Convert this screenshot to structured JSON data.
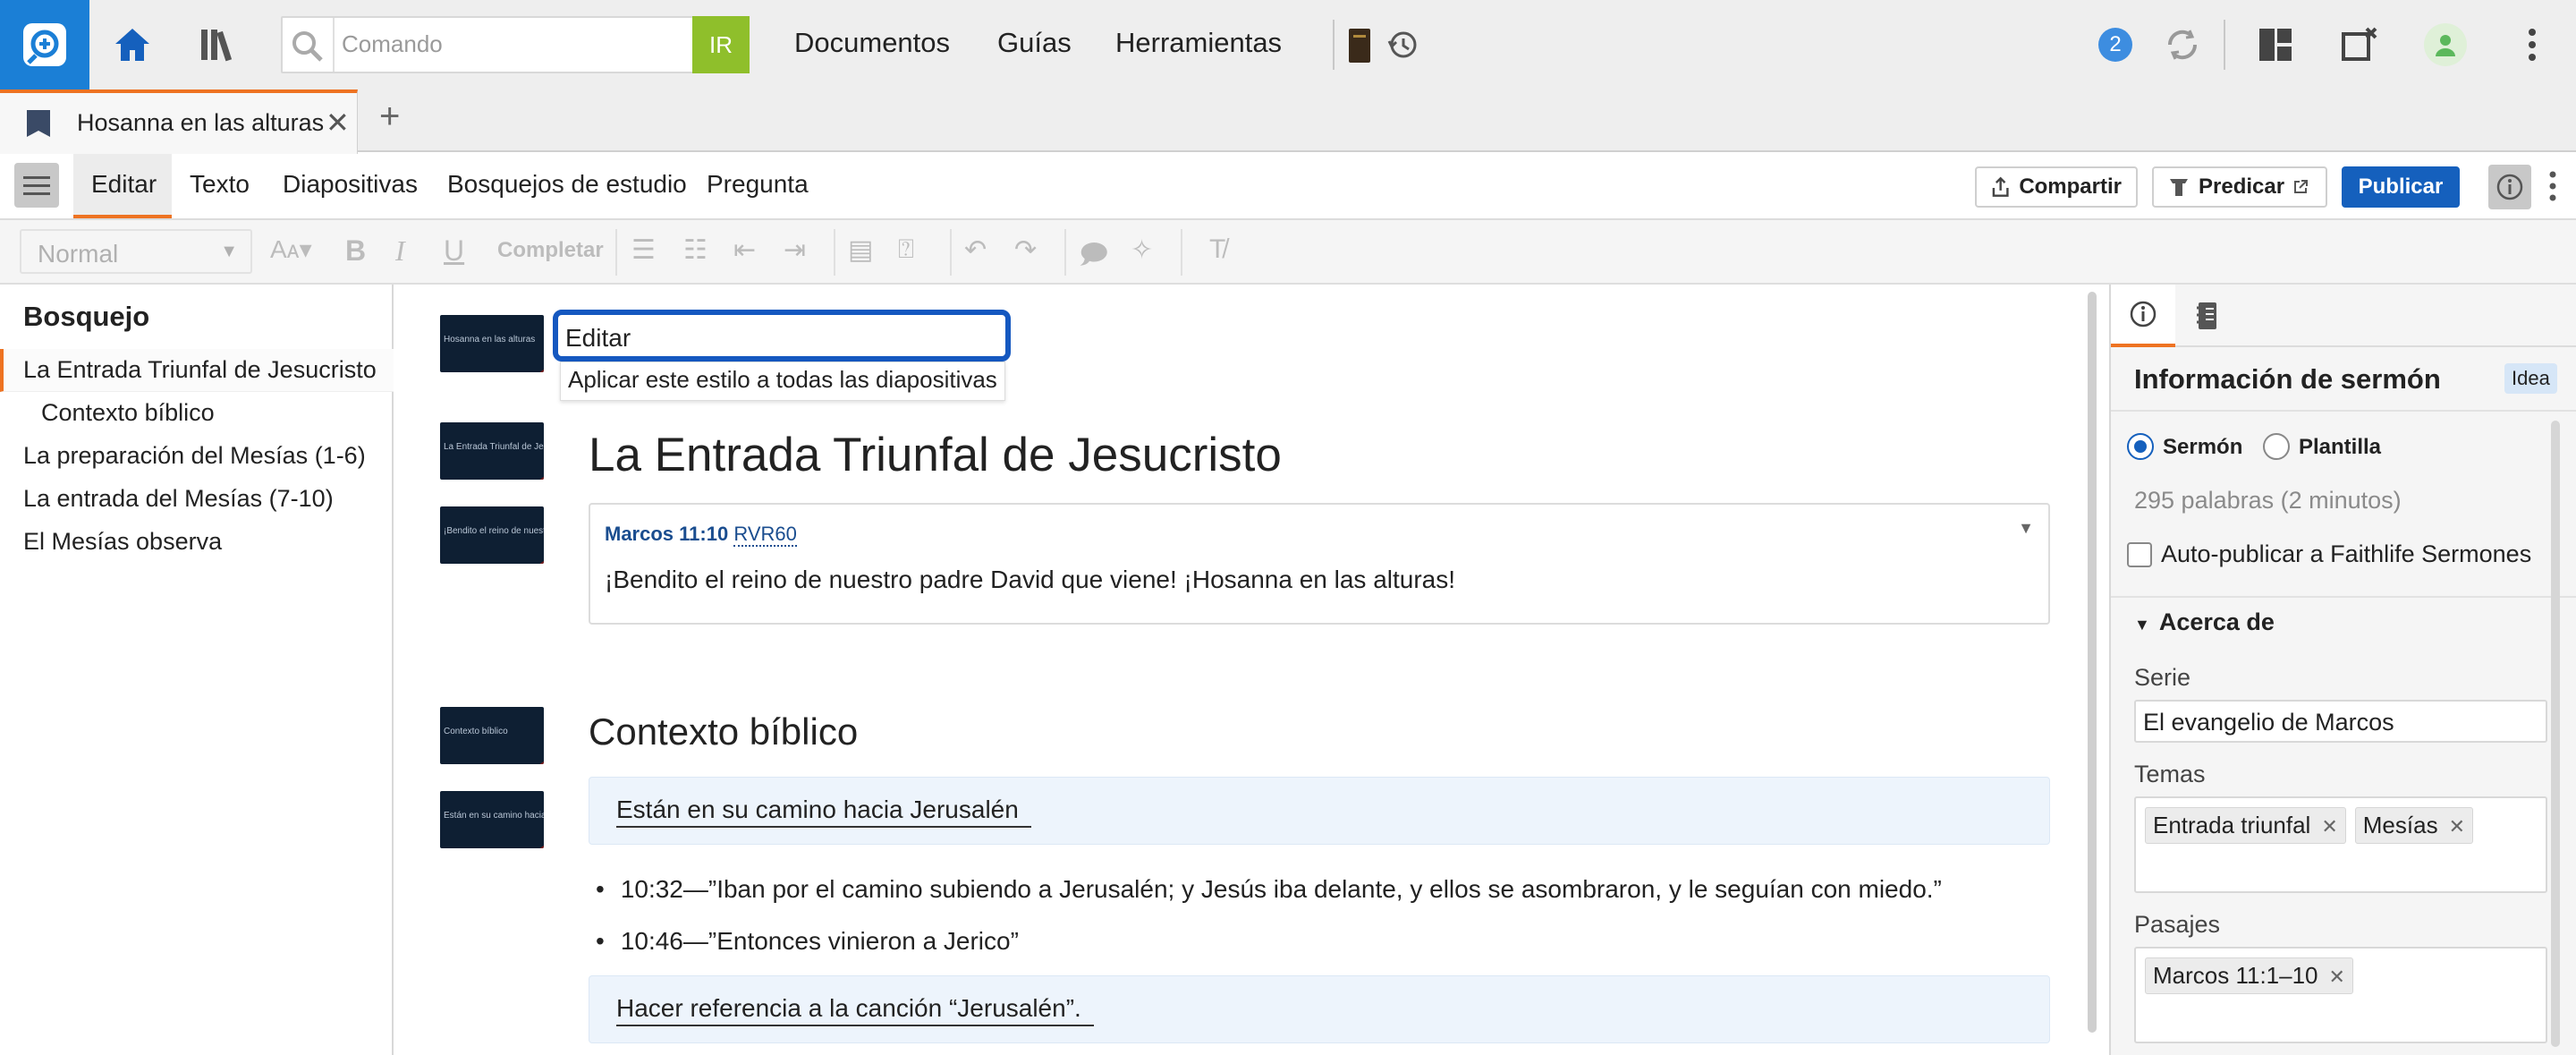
{
  "topbar": {
    "search_placeholder": "Comando",
    "go_label": "IR",
    "nav": [
      "Documentos",
      "Guías",
      "Herramientas"
    ],
    "notifications_count": "2"
  },
  "tab": {
    "title": "Hosanna en las alturas",
    "close": "✕",
    "add": "+"
  },
  "menu": {
    "items": [
      "Editar",
      "Texto",
      "Diapositivas",
      "Bosquejos de estudio",
      "Pregunta"
    ],
    "share": "Compartir",
    "preach": "Predicar",
    "publish": "Publicar"
  },
  "format": {
    "style": "Normal",
    "complete": "Completar"
  },
  "outline": {
    "heading": "Bosquejo",
    "items": [
      "La Entrada Triunfal de Jesucristo",
      "Contexto bíblico",
      "La preparación del Mesías (1-6)",
      "La entrada del Mesías (7-10)",
      "El Mesías observa"
    ]
  },
  "editor": {
    "title_input": "Editar",
    "apply_tip": "Aplicar este estilo a todas las diapositivas",
    "heading1": "La Entrada Triunfal de Jesucristo",
    "verse_ref": "Marcos 11:10",
    "verse_version": "RVR60",
    "verse_text": "¡Bendito el reino de nuestro padre David que viene! ¡Hosanna en las alturas!",
    "heading2": "Contexto bíblico",
    "highlight1": "Están en su camino hacia Jerusalén",
    "bullets": [
      "10:32—”Iban por el camino subiendo a Jerusalén; y Jesús iba delante, y ellos se asombraron, y le seguían con miedo.”",
      "10:46—”Entonces vinieron a Jerico”"
    ],
    "highlight2": "Hacer referencia a la canción “Jerusalén”.",
    "thumbs": [
      "Hosanna en las alturas",
      "La Entrada Triunfal de Jesucristo",
      "¡Bendito el reino de nuestro padre",
      "Contexto bíblico",
      "Están en su camino hacia Jerusalén"
    ]
  },
  "panel": {
    "title": "Información de sermón",
    "idea": "Idea",
    "radio_sermon": "Sermón",
    "radio_template": "Plantilla",
    "words": "295 palabras (2 minutos)",
    "autopublish": "Auto-publicar a Faithlife Sermones",
    "about": "Acerca de",
    "series_label": "Serie",
    "series_value": "El evangelio de Marcos",
    "topics_label": "Temas",
    "topics": [
      "Entrada triunfal",
      "Mesías"
    ],
    "passages_label": "Pasajes",
    "passages": [
      "Marcos 11:1–10"
    ]
  },
  "colors": {
    "accent": "#ee7322",
    "brand": "#1b7fd6",
    "primary": "#1560bd",
    "go": "#8fbf2b"
  }
}
